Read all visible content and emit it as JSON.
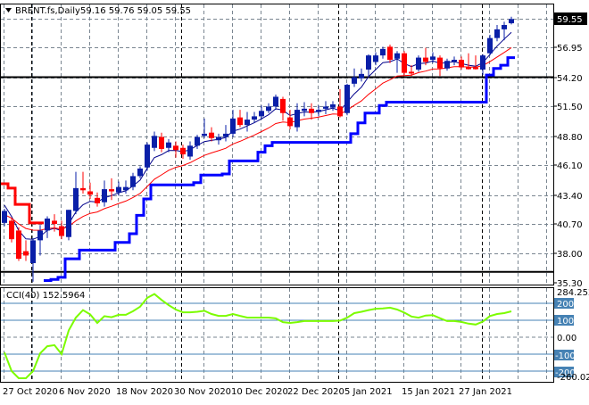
{
  "header": {
    "symbol": "BRENT.fs,Daily",
    "ohlc": "59.16 59.76 59.05 59.55",
    "collapse_icon": "triangle-down-icon"
  },
  "price_axis": {
    "labels": [
      "56.95",
      "54.20",
      "51.50",
      "48.80",
      "46.10",
      "43.40",
      "40.70",
      "38.00",
      "35.30"
    ],
    "current_price_label": "59.55"
  },
  "cci_panel": {
    "title": "CCI(40) 152.5964",
    "max_label": "284.2522",
    "min_label": "-260.028",
    "levels": [
      "200",
      "100",
      "0.00",
      "-100",
      "-200"
    ]
  },
  "time_axis": {
    "labels": [
      "27 Oct 2020",
      "6 Nov 2020",
      "18 Nov 2020",
      "30 Nov 2020",
      "10 Dec 2020",
      "22 Dec 2020",
      "5 Jan 2021",
      "15 Jan 2021",
      "27 Jan 2021"
    ]
  },
  "colors": {
    "bull": "#0a1fa8",
    "bear": "#ff0000",
    "fast_ma": "#00008b",
    "slow_ma": "#ff0000",
    "stop_up": "#0000ff",
    "stop_down": "#ff0000",
    "cci": "#7cfc00",
    "cci_level": "#4682b4",
    "h_level": "#000000"
  },
  "chart_data": {
    "type": "candlestick",
    "title": "BRENT.fs,Daily",
    "ylim": [
      35.3,
      59.95
    ],
    "horizontal_levels": [
      54.2,
      36.3
    ],
    "candles_ohlc": [
      [
        40.8,
        42.1,
        40.5,
        41.9
      ],
      [
        41.0,
        41.2,
        39.0,
        39.3
      ],
      [
        40.1,
        40.4,
        37.3,
        37.5
      ],
      [
        38.2,
        39.2,
        37.3,
        37.8
      ],
      [
        37.1,
        39.4,
        35.4,
        39.2
      ],
      [
        39.2,
        40.6,
        37.8,
        40.1
      ],
      [
        40.1,
        41.4,
        39.4,
        41.2
      ],
      [
        41.0,
        41.6,
        40.0,
        40.7
      ],
      [
        40.5,
        41.0,
        39.3,
        39.6
      ],
      [
        39.5,
        42.0,
        39.2,
        42.0
      ],
      [
        41.9,
        45.5,
        41.6,
        44.0
      ],
      [
        44.0,
        45.5,
        43.5,
        43.8
      ],
      [
        43.7,
        44.5,
        43.0,
        43.4
      ],
      [
        43.1,
        43.6,
        42.3,
        42.6
      ],
      [
        42.7,
        44.7,
        42.3,
        43.9
      ],
      [
        43.9,
        44.9,
        42.9,
        43.7
      ],
      [
        43.6,
        44.6,
        43.3,
        44.1
      ],
      [
        43.8,
        44.7,
        43.5,
        44.1
      ],
      [
        44.1,
        45.4,
        43.8,
        45.1
      ],
      [
        45.1,
        46.0,
        44.9,
        45.8
      ],
      [
        45.9,
        48.2,
        45.6,
        48.0
      ],
      [
        47.7,
        49.2,
        47.4,
        48.8
      ],
      [
        48.7,
        49.1,
        47.3,
        47.6
      ],
      [
        47.7,
        48.5,
        47.3,
        48.2
      ],
      [
        47.9,
        48.3,
        46.8,
        47.5
      ],
      [
        47.7,
        48.0,
        46.7,
        47.1
      ],
      [
        46.9,
        48.3,
        46.6,
        47.9
      ],
      [
        47.9,
        48.9,
        47.6,
        48.7
      ],
      [
        48.8,
        50.4,
        48.6,
        49.0
      ],
      [
        49.1,
        49.6,
        48.3,
        48.6
      ],
      [
        48.4,
        49.0,
        48.0,
        48.7
      ],
      [
        48.7,
        49.8,
        48.3,
        49.0
      ],
      [
        49.0,
        51.2,
        48.7,
        50.4
      ],
      [
        50.5,
        51.2,
        49.6,
        49.8
      ],
      [
        49.8,
        51.0,
        49.2,
        50.3
      ],
      [
        50.3,
        51.0,
        50.0,
        50.6
      ],
      [
        50.6,
        51.6,
        50.3,
        51.1
      ],
      [
        51.1,
        51.8,
        50.9,
        51.5
      ],
      [
        51.5,
        52.6,
        51.2,
        52.4
      ],
      [
        52.2,
        52.4,
        50.2,
        50.9
      ],
      [
        50.5,
        51.2,
        49.4,
        49.7
      ],
      [
        49.6,
        51.8,
        49.2,
        51.2
      ],
      [
        51.1,
        51.9,
        50.6,
        51.3
      ],
      [
        51.3,
        51.8,
        50.3,
        50.9
      ],
      [
        51.0,
        51.6,
        50.6,
        51.2
      ],
      [
        51.3,
        52.0,
        50.8,
        51.5
      ],
      [
        51.4,
        52.0,
        51.1,
        51.7
      ],
      [
        51.5,
        53.1,
        50.5,
        50.6
      ],
      [
        50.9,
        53.6,
        50.7,
        53.5
      ],
      [
        53.6,
        55.0,
        53.3,
        54.2
      ],
      [
        54.1,
        55.0,
        53.8,
        54.5
      ],
      [
        54.9,
        56.3,
        54.3,
        56.2
      ],
      [
        55.6,
        56.5,
        55.3,
        56.2
      ],
      [
        56.2,
        57.0,
        55.9,
        56.8
      ],
      [
        57.0,
        57.2,
        55.5,
        55.8
      ],
      [
        55.9,
        56.6,
        54.6,
        56.4
      ],
      [
        56.4,
        56.6,
        54.4,
        54.6
      ],
      [
        54.7,
        55.3,
        54.3,
        54.6
      ],
      [
        54.9,
        56.2,
        54.7,
        56.0
      ],
      [
        56.0,
        56.9,
        55.3,
        55.6
      ],
      [
        55.8,
        56.5,
        55.5,
        56.1
      ],
      [
        56.0,
        56.2,
        54.3,
        55.0
      ],
      [
        55.0,
        55.9,
        54.8,
        55.7
      ],
      [
        55.7,
        56.1,
        55.3,
        55.8
      ],
      [
        55.8,
        56.1,
        54.9,
        55.1
      ],
      [
        55.1,
        56.4,
        54.9,
        55.0
      ],
      [
        55.1,
        56.2,
        54.9,
        55.0
      ],
      [
        54.9,
        56.3,
        54.4,
        56.2
      ],
      [
        56.4,
        58.1,
        56.2,
        57.8
      ],
      [
        57.8,
        59.0,
        57.5,
        58.6
      ],
      [
        58.6,
        59.3,
        57.6,
        59.0
      ],
      [
        59.16,
        59.76,
        59.05,
        59.55
      ]
    ],
    "trailing_stop": [
      44.4,
      44.0,
      42.5,
      42.5,
      40.8,
      40.8,
      35.5,
      35.6,
      35.8,
      37.5,
      37.5,
      38.3,
      38.3,
      38.3,
      38.3,
      38.3,
      39.0,
      39.0,
      39.8,
      41.5,
      43.0,
      44.3,
      44.3,
      44.3,
      44.3,
      44.3,
      44.3,
      44.5,
      45.2,
      45.2,
      45.2,
      45.3,
      46.5,
      46.5,
      46.5,
      46.5,
      47.3,
      47.9,
      48.2,
      48.2,
      48.2,
      48.2,
      48.2,
      48.2,
      48.2,
      48.2,
      48.2,
      48.2,
      48.2,
      49.0,
      50.0,
      50.9,
      50.9,
      51.6,
      51.9,
      51.9,
      51.9,
      51.9,
      51.9,
      51.9,
      51.9,
      51.9,
      51.9,
      51.9,
      51.9,
      51.9,
      51.9,
      51.9,
      54.4,
      55.0,
      55.3,
      56.0
    ],
    "trailing_stop_bearish_count": 6,
    "fast_ma_seed": 42.7,
    "slow_ma_seed": 41.5,
    "cci": {
      "period": 40,
      "ylim": [
        -260.028,
        284.2522
      ],
      "values": [
        -90,
        -200,
        -242,
        -242,
        -200,
        -95,
        -53,
        -47,
        -100,
        40,
        116,
        160,
        135,
        84,
        124,
        118,
        132,
        132,
        153,
        180,
        232,
        255,
        220,
        189,
        163,
        147,
        147,
        150,
        156,
        137,
        126,
        126,
        137,
        126,
        116,
        116,
        116,
        116,
        111,
        89,
        84,
        89,
        95,
        95,
        95,
        95,
        95,
        98,
        115,
        142,
        150,
        160,
        168,
        170,
        174,
        163,
        145,
        122,
        115,
        128,
        130,
        112,
        95,
        95,
        90,
        80,
        75,
        92,
        125,
        137,
        142,
        152.5964
      ]
    }
  }
}
